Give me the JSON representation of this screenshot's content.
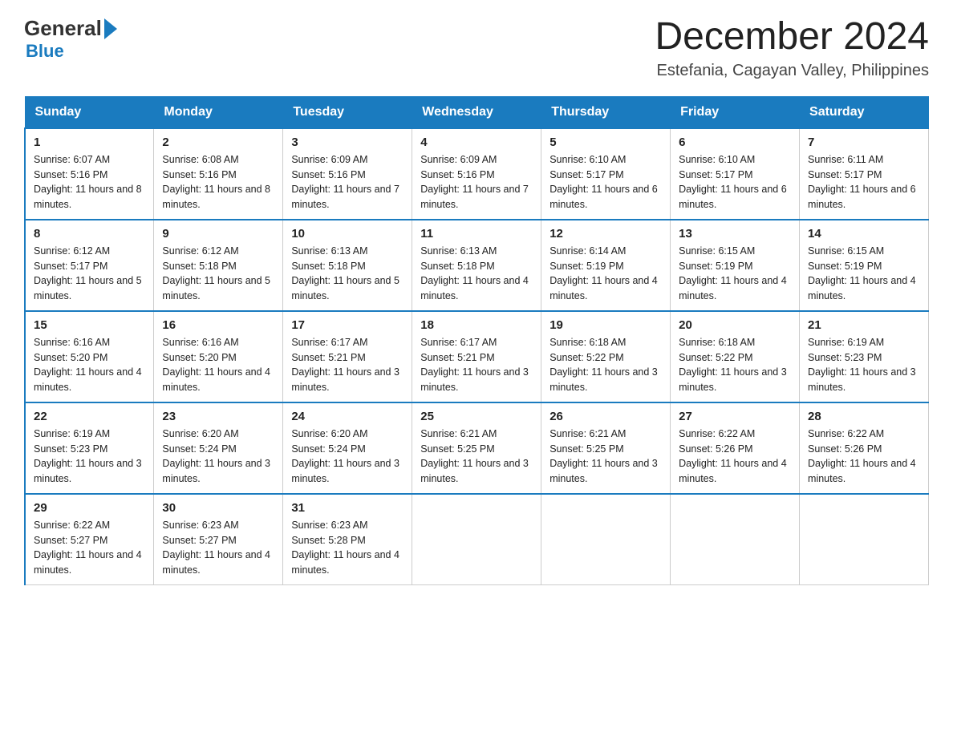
{
  "header": {
    "logo_general": "General",
    "logo_blue": "Blue",
    "month_title": "December 2024",
    "location": "Estefania, Cagayan Valley, Philippines"
  },
  "weekdays": [
    "Sunday",
    "Monday",
    "Tuesday",
    "Wednesday",
    "Thursday",
    "Friday",
    "Saturday"
  ],
  "weeks": [
    [
      {
        "day": "1",
        "sunrise": "Sunrise: 6:07 AM",
        "sunset": "Sunset: 5:16 PM",
        "daylight": "Daylight: 11 hours and 8 minutes."
      },
      {
        "day": "2",
        "sunrise": "Sunrise: 6:08 AM",
        "sunset": "Sunset: 5:16 PM",
        "daylight": "Daylight: 11 hours and 8 minutes."
      },
      {
        "day": "3",
        "sunrise": "Sunrise: 6:09 AM",
        "sunset": "Sunset: 5:16 PM",
        "daylight": "Daylight: 11 hours and 7 minutes."
      },
      {
        "day": "4",
        "sunrise": "Sunrise: 6:09 AM",
        "sunset": "Sunset: 5:16 PM",
        "daylight": "Daylight: 11 hours and 7 minutes."
      },
      {
        "day": "5",
        "sunrise": "Sunrise: 6:10 AM",
        "sunset": "Sunset: 5:17 PM",
        "daylight": "Daylight: 11 hours and 6 minutes."
      },
      {
        "day": "6",
        "sunrise": "Sunrise: 6:10 AM",
        "sunset": "Sunset: 5:17 PM",
        "daylight": "Daylight: 11 hours and 6 minutes."
      },
      {
        "day": "7",
        "sunrise": "Sunrise: 6:11 AM",
        "sunset": "Sunset: 5:17 PM",
        "daylight": "Daylight: 11 hours and 6 minutes."
      }
    ],
    [
      {
        "day": "8",
        "sunrise": "Sunrise: 6:12 AM",
        "sunset": "Sunset: 5:17 PM",
        "daylight": "Daylight: 11 hours and 5 minutes."
      },
      {
        "day": "9",
        "sunrise": "Sunrise: 6:12 AM",
        "sunset": "Sunset: 5:18 PM",
        "daylight": "Daylight: 11 hours and 5 minutes."
      },
      {
        "day": "10",
        "sunrise": "Sunrise: 6:13 AM",
        "sunset": "Sunset: 5:18 PM",
        "daylight": "Daylight: 11 hours and 5 minutes."
      },
      {
        "day": "11",
        "sunrise": "Sunrise: 6:13 AM",
        "sunset": "Sunset: 5:18 PM",
        "daylight": "Daylight: 11 hours and 4 minutes."
      },
      {
        "day": "12",
        "sunrise": "Sunrise: 6:14 AM",
        "sunset": "Sunset: 5:19 PM",
        "daylight": "Daylight: 11 hours and 4 minutes."
      },
      {
        "day": "13",
        "sunrise": "Sunrise: 6:15 AM",
        "sunset": "Sunset: 5:19 PM",
        "daylight": "Daylight: 11 hours and 4 minutes."
      },
      {
        "day": "14",
        "sunrise": "Sunrise: 6:15 AM",
        "sunset": "Sunset: 5:19 PM",
        "daylight": "Daylight: 11 hours and 4 minutes."
      }
    ],
    [
      {
        "day": "15",
        "sunrise": "Sunrise: 6:16 AM",
        "sunset": "Sunset: 5:20 PM",
        "daylight": "Daylight: 11 hours and 4 minutes."
      },
      {
        "day": "16",
        "sunrise": "Sunrise: 6:16 AM",
        "sunset": "Sunset: 5:20 PM",
        "daylight": "Daylight: 11 hours and 4 minutes."
      },
      {
        "day": "17",
        "sunrise": "Sunrise: 6:17 AM",
        "sunset": "Sunset: 5:21 PM",
        "daylight": "Daylight: 11 hours and 3 minutes."
      },
      {
        "day": "18",
        "sunrise": "Sunrise: 6:17 AM",
        "sunset": "Sunset: 5:21 PM",
        "daylight": "Daylight: 11 hours and 3 minutes."
      },
      {
        "day": "19",
        "sunrise": "Sunrise: 6:18 AM",
        "sunset": "Sunset: 5:22 PM",
        "daylight": "Daylight: 11 hours and 3 minutes."
      },
      {
        "day": "20",
        "sunrise": "Sunrise: 6:18 AM",
        "sunset": "Sunset: 5:22 PM",
        "daylight": "Daylight: 11 hours and 3 minutes."
      },
      {
        "day": "21",
        "sunrise": "Sunrise: 6:19 AM",
        "sunset": "Sunset: 5:23 PM",
        "daylight": "Daylight: 11 hours and 3 minutes."
      }
    ],
    [
      {
        "day": "22",
        "sunrise": "Sunrise: 6:19 AM",
        "sunset": "Sunset: 5:23 PM",
        "daylight": "Daylight: 11 hours and 3 minutes."
      },
      {
        "day": "23",
        "sunrise": "Sunrise: 6:20 AM",
        "sunset": "Sunset: 5:24 PM",
        "daylight": "Daylight: 11 hours and 3 minutes."
      },
      {
        "day": "24",
        "sunrise": "Sunrise: 6:20 AM",
        "sunset": "Sunset: 5:24 PM",
        "daylight": "Daylight: 11 hours and 3 minutes."
      },
      {
        "day": "25",
        "sunrise": "Sunrise: 6:21 AM",
        "sunset": "Sunset: 5:25 PM",
        "daylight": "Daylight: 11 hours and 3 minutes."
      },
      {
        "day": "26",
        "sunrise": "Sunrise: 6:21 AM",
        "sunset": "Sunset: 5:25 PM",
        "daylight": "Daylight: 11 hours and 3 minutes."
      },
      {
        "day": "27",
        "sunrise": "Sunrise: 6:22 AM",
        "sunset": "Sunset: 5:26 PM",
        "daylight": "Daylight: 11 hours and 4 minutes."
      },
      {
        "day": "28",
        "sunrise": "Sunrise: 6:22 AM",
        "sunset": "Sunset: 5:26 PM",
        "daylight": "Daylight: 11 hours and 4 minutes."
      }
    ],
    [
      {
        "day": "29",
        "sunrise": "Sunrise: 6:22 AM",
        "sunset": "Sunset: 5:27 PM",
        "daylight": "Daylight: 11 hours and 4 minutes."
      },
      {
        "day": "30",
        "sunrise": "Sunrise: 6:23 AM",
        "sunset": "Sunset: 5:27 PM",
        "daylight": "Daylight: 11 hours and 4 minutes."
      },
      {
        "day": "31",
        "sunrise": "Sunrise: 6:23 AM",
        "sunset": "Sunset: 5:28 PM",
        "daylight": "Daylight: 11 hours and 4 minutes."
      },
      null,
      null,
      null,
      null
    ]
  ]
}
